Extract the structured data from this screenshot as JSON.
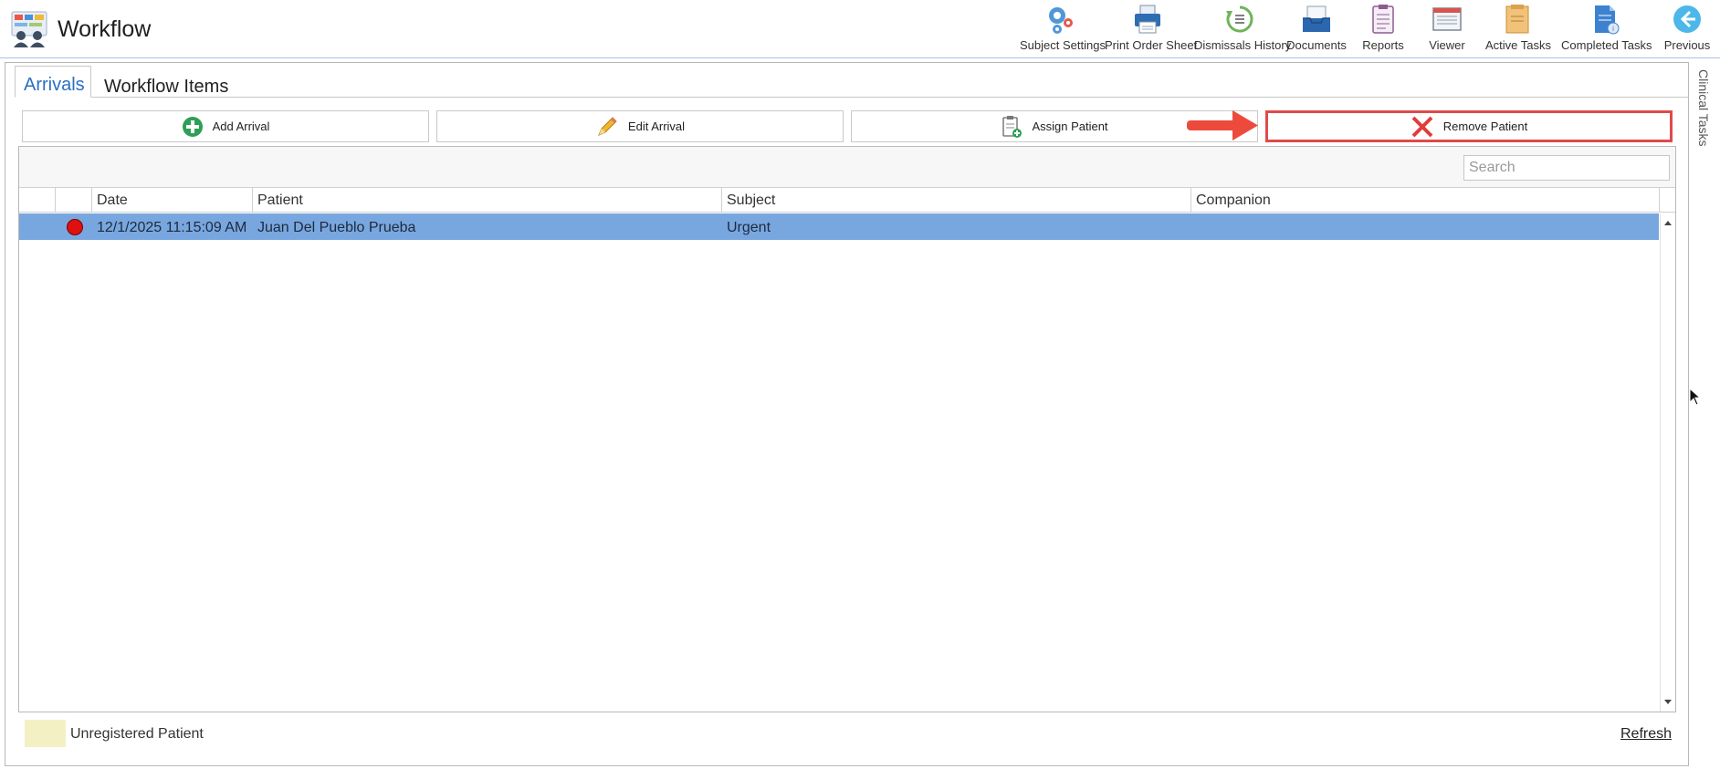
{
  "header": {
    "title": "Workflow",
    "toolbar": [
      {
        "id": "subject-settings",
        "label": "Subject Settings",
        "icon": "gears-icon"
      },
      {
        "id": "print-order-sheet",
        "label": "Print Order Sheet",
        "icon": "printer-icon"
      },
      {
        "id": "dismissals-history",
        "label": "Dismissals History",
        "icon": "history-icon"
      },
      {
        "id": "documents",
        "label": "Documents",
        "icon": "inbox-tray-icon"
      },
      {
        "id": "reports",
        "label": "Reports",
        "icon": "clipboard-icon"
      },
      {
        "id": "viewer",
        "label": "Viewer",
        "icon": "viewer-window-icon"
      },
      {
        "id": "active-tasks",
        "label": "Active Tasks",
        "icon": "task-folder-icon"
      },
      {
        "id": "completed-tasks",
        "label": "Completed Tasks",
        "icon": "completed-document-icon"
      },
      {
        "id": "previous",
        "label": "Previous",
        "icon": "back-arrow-icon"
      }
    ]
  },
  "tabs": [
    {
      "label": "Arrivals",
      "active": true
    },
    {
      "label": "Workflow Items",
      "active": false
    }
  ],
  "side_panel": {
    "label": "Clinical Tasks"
  },
  "actions": {
    "add_arrival": "Add Arrival",
    "edit_arrival": "Edit Arrival",
    "assign_patient": "Assign Patient",
    "remove_patient": "Remove Patient"
  },
  "search": {
    "placeholder": "Search",
    "value": ""
  },
  "grid": {
    "columns": [
      "",
      "",
      "Date",
      "Patient",
      "Subject",
      "Companion"
    ],
    "rows": [
      {
        "status_color": "#e01010",
        "date": "12/1/2025 11:15:09 AM",
        "patient": "Juan Del Pueblo Prueba",
        "subject": "Urgent",
        "companion": "",
        "selected": true
      }
    ]
  },
  "legend": {
    "label": "Unregistered Patient",
    "color": "#f3f1c4"
  },
  "refresh_label": "Refresh",
  "colors": {
    "accent": "#2a6fc2",
    "selected_row": "#78a7e0",
    "highlight_border": "#e04a4a"
  }
}
